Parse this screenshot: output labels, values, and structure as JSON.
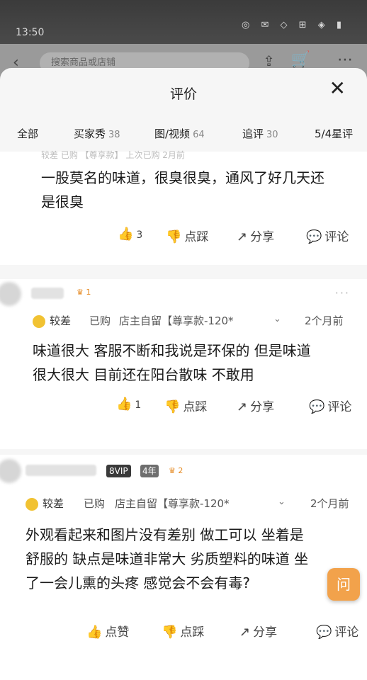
{
  "status": {
    "time": "13:50",
    "icons": "◎ ✉ ◇ ⊞ ◈ ▮"
  },
  "background_nav": {
    "search_placeholder": "搜索商品或店铺"
  },
  "sheet": {
    "title": "评价",
    "tabs": [
      {
        "label": "全部",
        "count": ""
      },
      {
        "label": "买家秀",
        "count": "38"
      },
      {
        "label": "图/视频",
        "count": "64"
      },
      {
        "label": "追评",
        "count": "30"
      },
      {
        "label": "5/4星评",
        "count": ""
      }
    ]
  },
  "reviews": [
    {
      "cut_meta": "较差  已购 【尊享款】 上次已购 2月前",
      "text_lines": [
        "一股莫名的味道，很臭很臭，通风了好几天还",
        "是很臭"
      ],
      "like_count": "3",
      "dislike_label": "点踩",
      "share_label": "分享",
      "comment_label": "评论"
    },
    {
      "level": "1",
      "rating": "较差",
      "bought": "已购",
      "variant": "店主自留【尊享款-120*",
      "date": "2个月前",
      "text_lines": [
        "味道很大 客服不断和我说是环保的 但是味道",
        "很大很大 目前还在阳台散味 不敢用"
      ],
      "like_count": "1",
      "dislike_label": "点踩",
      "share_label": "分享",
      "comment_label": "评论"
    },
    {
      "vip": "8VIP",
      "years": "4年",
      "level": "2",
      "rating": "较差",
      "bought": "已购",
      "variant": "店主自留【尊享款-120*",
      "date": "2个月前",
      "text_lines": [
        "外观看起来和图片没有差别 做工可以 坐着是",
        "舒服的 缺点是味道非常大 劣质塑料的味道 坐",
        "了一会儿熏的头疼 感觉会不会有毒?"
      ],
      "like_label": "点赞",
      "dislike_label": "点踩",
      "share_label": "分享",
      "comment_label": "评论"
    }
  ],
  "float_button": "问"
}
